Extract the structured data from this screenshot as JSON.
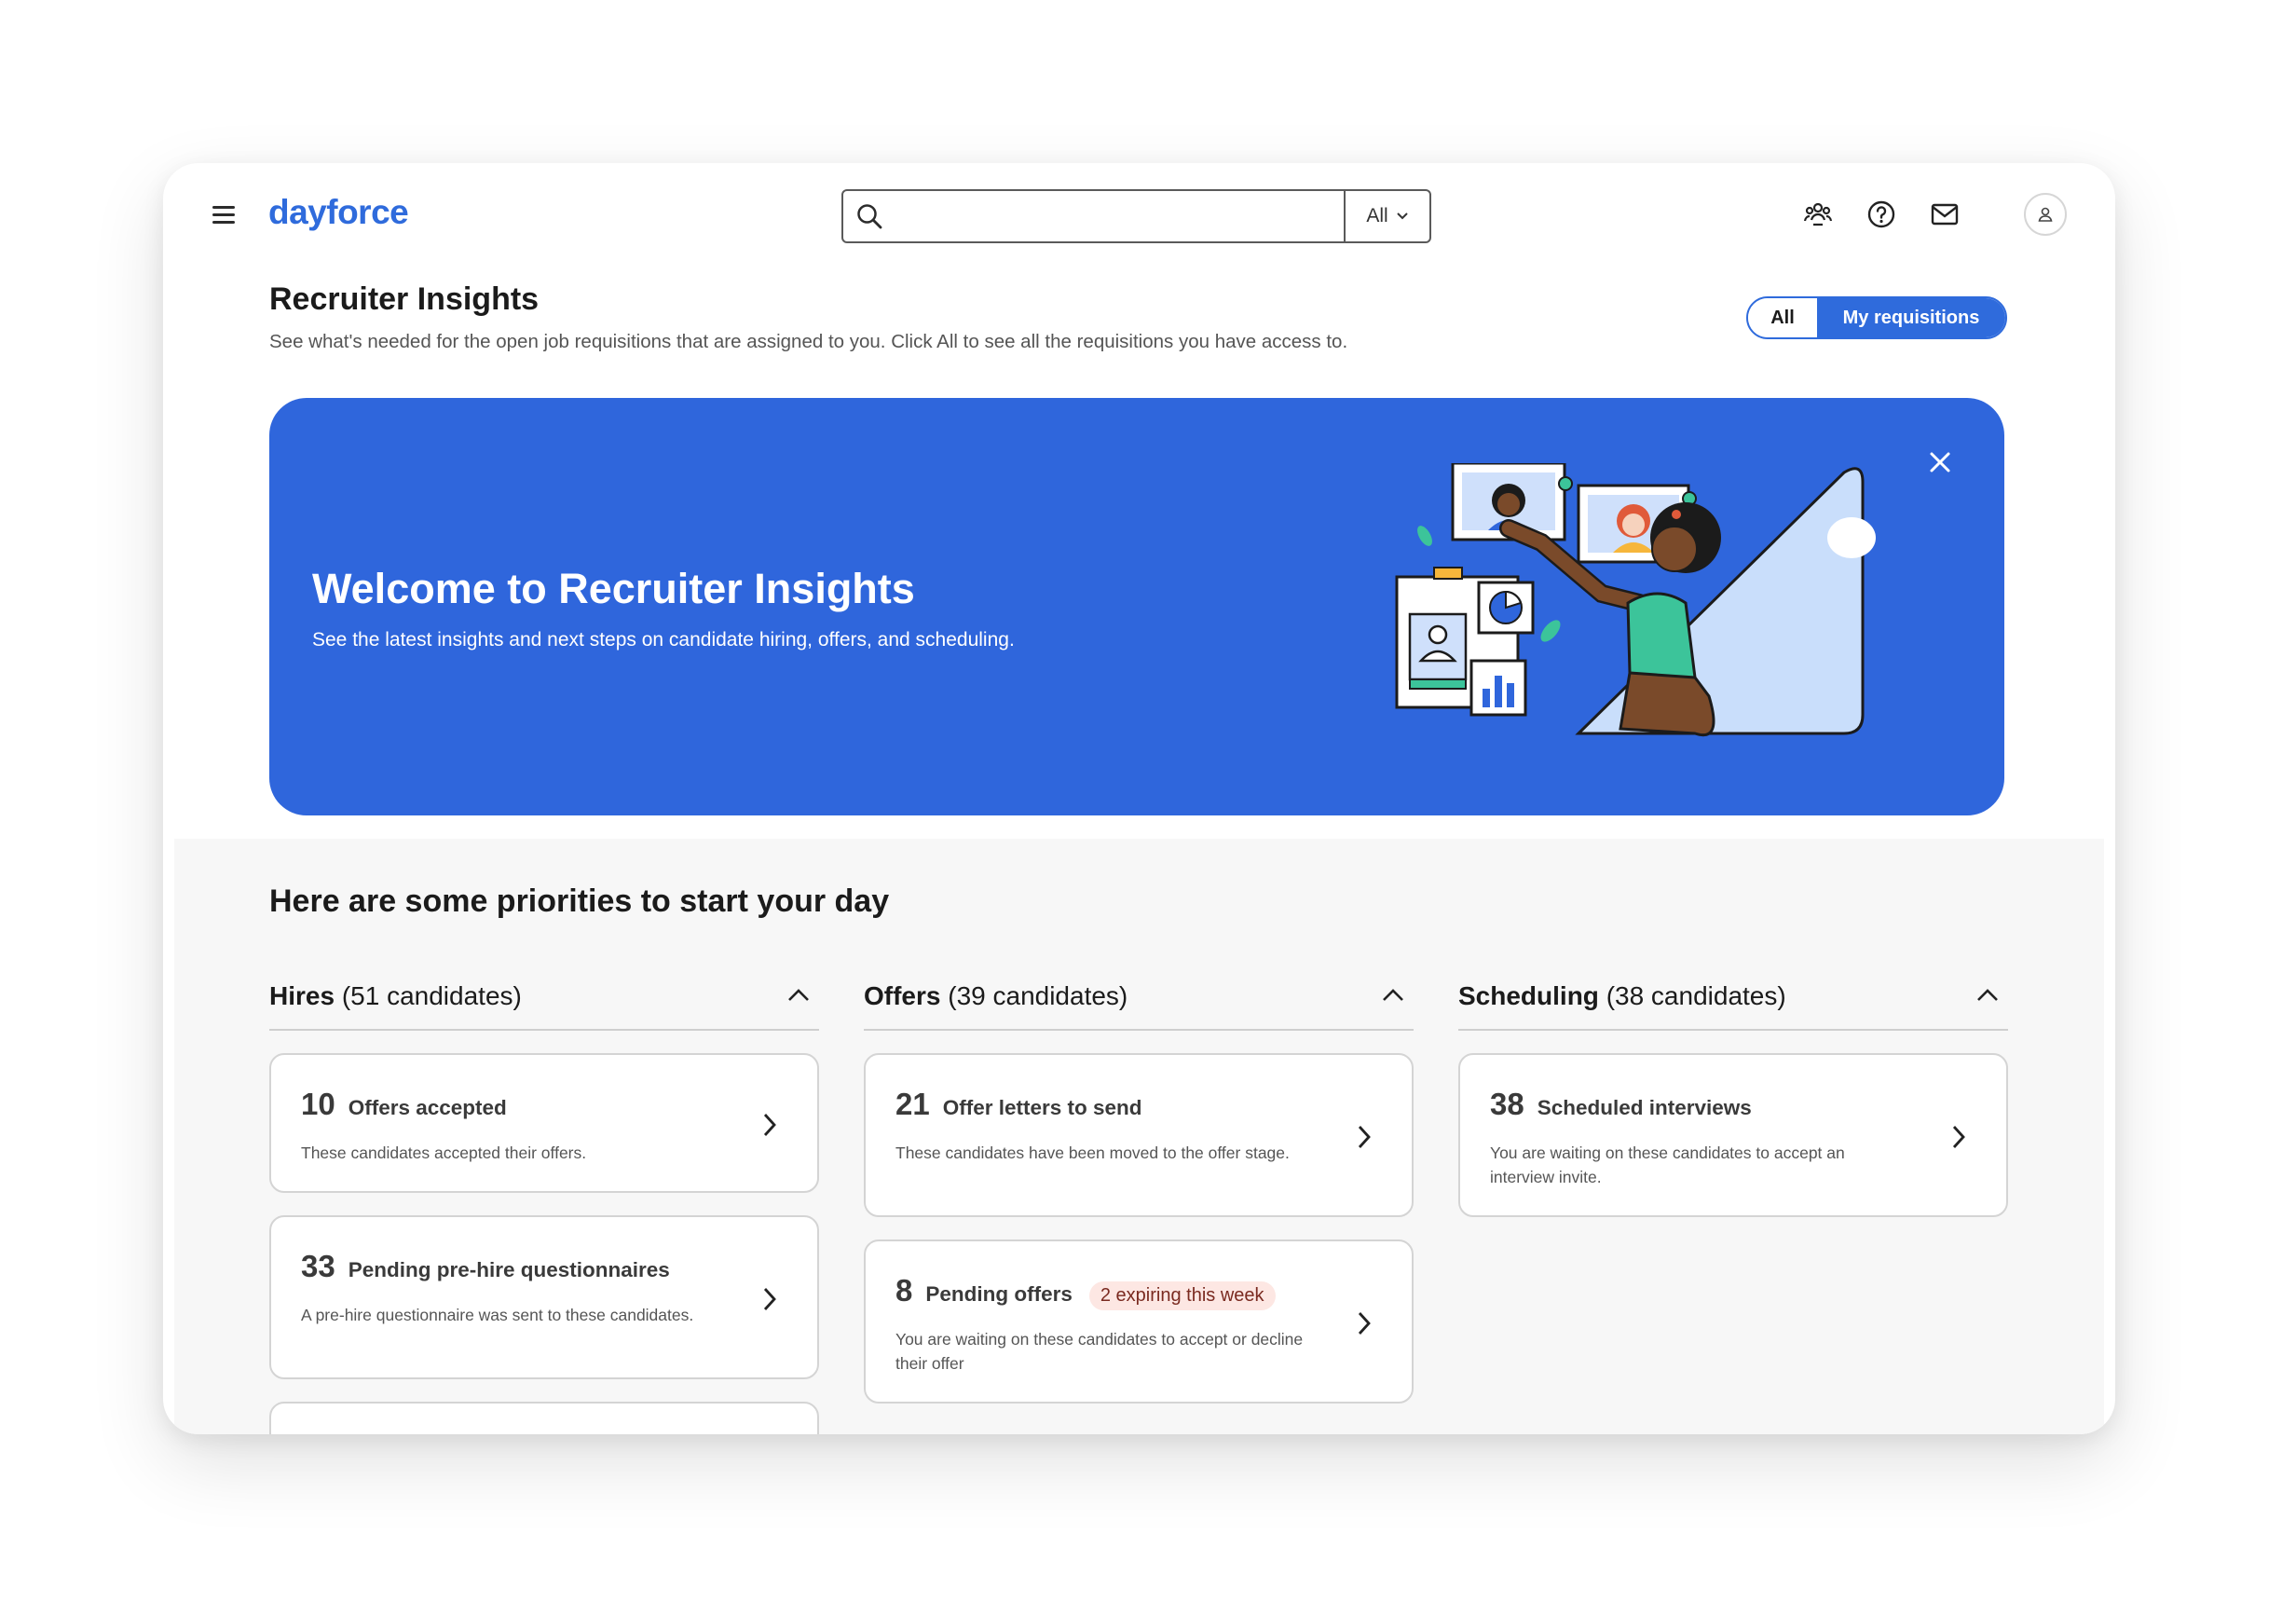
{
  "header": {
    "logo": "dayforce",
    "search_placeholder": "",
    "search_scope": "All"
  },
  "page": {
    "title": "Recruiter Insights",
    "subtitle": "See what's needed for the open job requisitions that are assigned to you. Click All to see all the requisitions you have access to.",
    "toggle": {
      "all": "All",
      "mine": "My requisitions",
      "selected": "My requisitions"
    }
  },
  "banner": {
    "title": "Welcome to Recruiter Insights",
    "text": "See the latest insights and next steps on candidate hiring, offers, and scheduling."
  },
  "priorities": {
    "title": "Here are some priorities to start your day",
    "columns": [
      {
        "name": "Hires",
        "count": "(51 candidates)",
        "cards": [
          {
            "count": "10",
            "label": "Offers accepted",
            "desc": "These candidates accepted their offers.",
            "badge": ""
          },
          {
            "count": "33",
            "label": "Pending pre-hire questionnaires",
            "desc": "A pre-hire questionnaire was sent to these candidates.",
            "badge": ""
          }
        ]
      },
      {
        "name": "Offers",
        "count": "(39 candidates)",
        "cards": [
          {
            "count": "21",
            "label": "Offer letters to send",
            "desc": "These candidates have been moved to the offer stage.",
            "badge": ""
          },
          {
            "count": "8",
            "label": "Pending offers",
            "desc": "You are waiting on these candidates to accept or decline their offer",
            "badge": "2 expiring this week"
          }
        ]
      },
      {
        "name": "Scheduling",
        "count": "(38 candidates)",
        "cards": [
          {
            "count": "38",
            "label": "Scheduled interviews",
            "desc": "You are waiting on these candidates to accept an interview invite.",
            "badge": ""
          }
        ]
      }
    ]
  },
  "colors": {
    "accent": "#2f6bdc",
    "banner": "#2f66dc",
    "badge_bg": "#fde7e3"
  },
  "icons": {
    "menu": "hamburger-icon",
    "search": "search-icon",
    "team": "people-icon",
    "help": "help-icon",
    "mail": "mail-icon",
    "user": "user-icon",
    "close": "close-icon",
    "collapse": "chevron-up-icon",
    "open": "chevron-right-icon"
  }
}
